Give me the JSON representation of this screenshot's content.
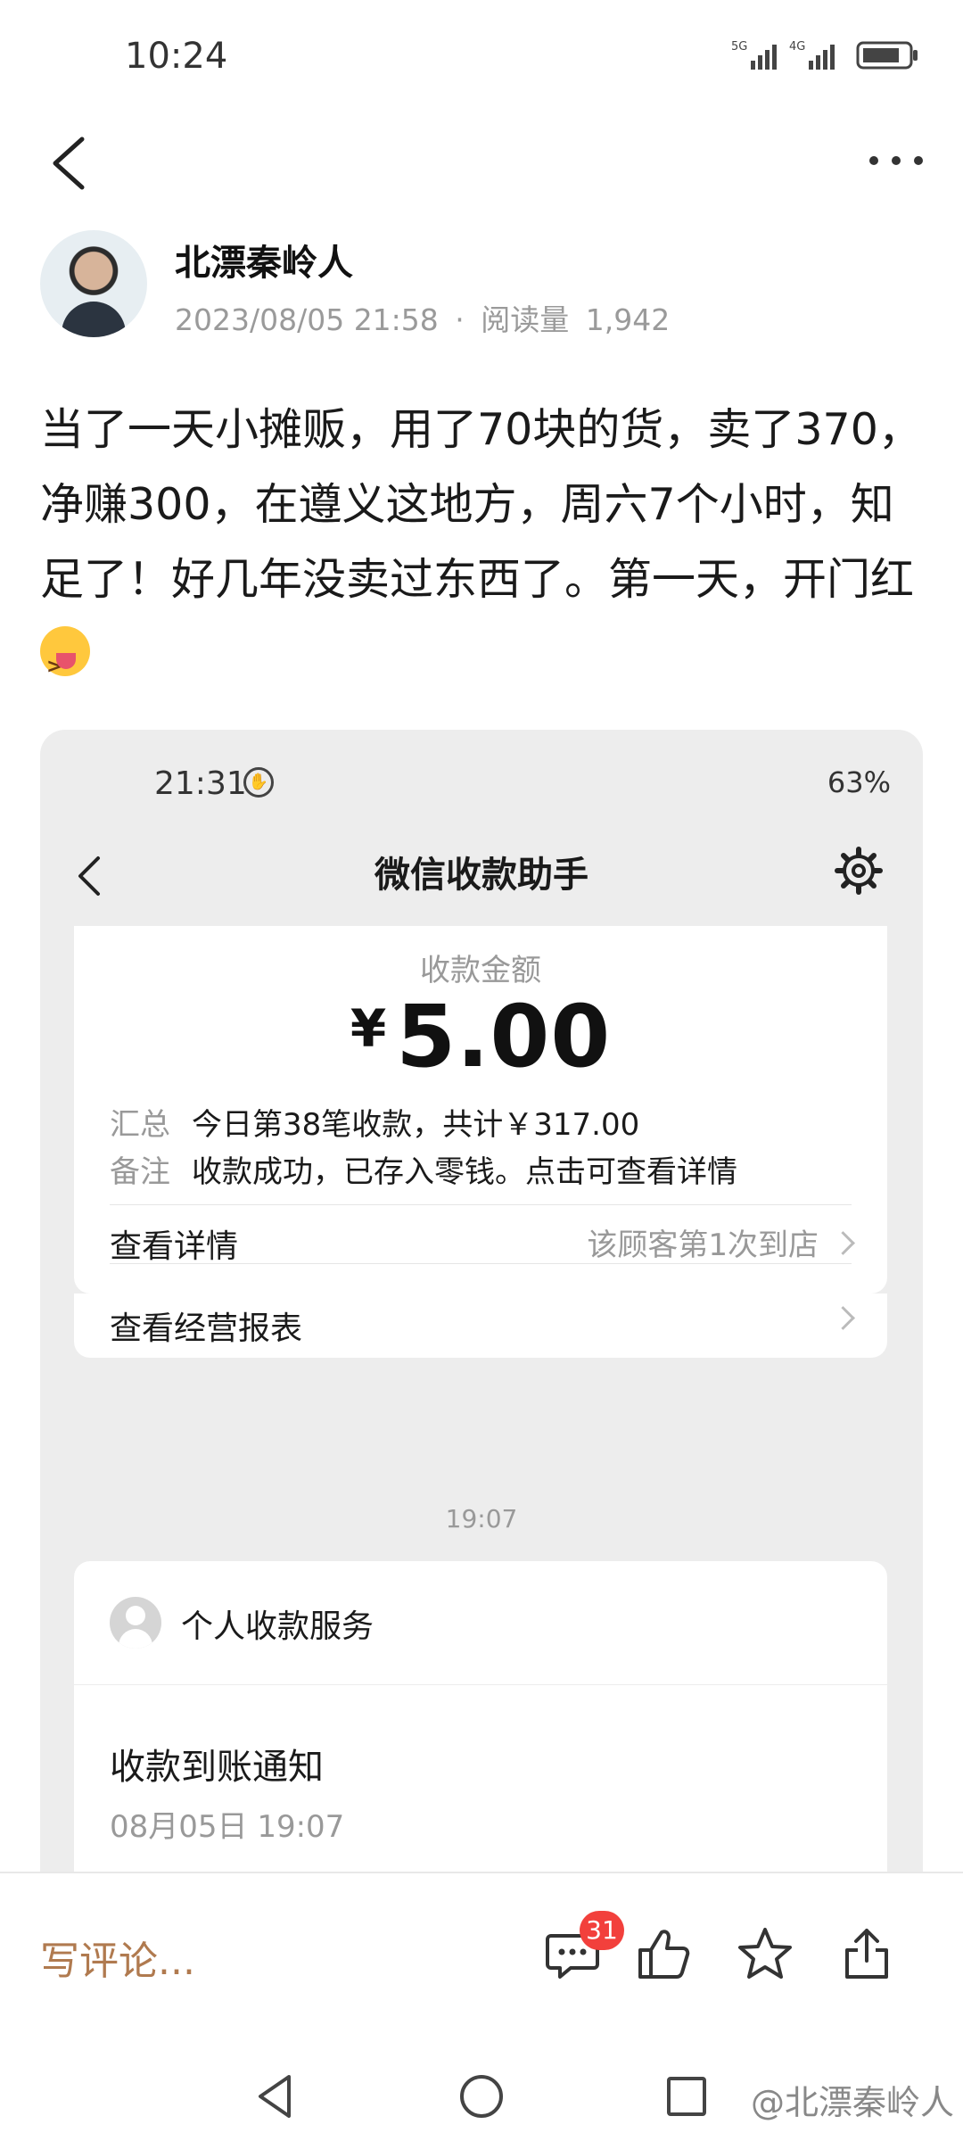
{
  "status_bar": {
    "time": "10:24",
    "net1": "5G",
    "net2": "4G"
  },
  "author": {
    "name": "北漂秦岭人",
    "datetime": "2023/08/05 21:58",
    "separator": "·",
    "reads_label": "阅读量",
    "reads": "1,942"
  },
  "post": {
    "text": "当了一天小摊贩，用了70块的货，卖了370，净赚300，在遵义这地方，周六7个小时，知足了！好几年没卖过东西了。第一天，开门红",
    "emoji": "squinting-face-with-tongue"
  },
  "screenshot": {
    "status_time": "21:31",
    "status_right": "63%",
    "title": "微信收款助手",
    "amount_label": "收款金额",
    "currency": "¥",
    "amount": "5.00",
    "summary_key": "汇总",
    "summary_value": "今日第38笔收款，共计￥317.00",
    "note_key": "备注",
    "note_value": "收款成功，已存入零钱。点击可查看详情",
    "details_label": "查看详情",
    "details_value": "该顾客第1次到店",
    "report_label": "查看经营报表",
    "timestamp": "19:07",
    "service_name": "个人收款服务",
    "notice_title": "收款到账通知",
    "notice_date": "08月05日 19:07"
  },
  "actions": {
    "comment_placeholder": "写评论...",
    "comment_count": "31"
  },
  "watermark": "@北漂秦岭人",
  "colors": {
    "accent": "#b07a4f",
    "badge": "#f2403c"
  }
}
